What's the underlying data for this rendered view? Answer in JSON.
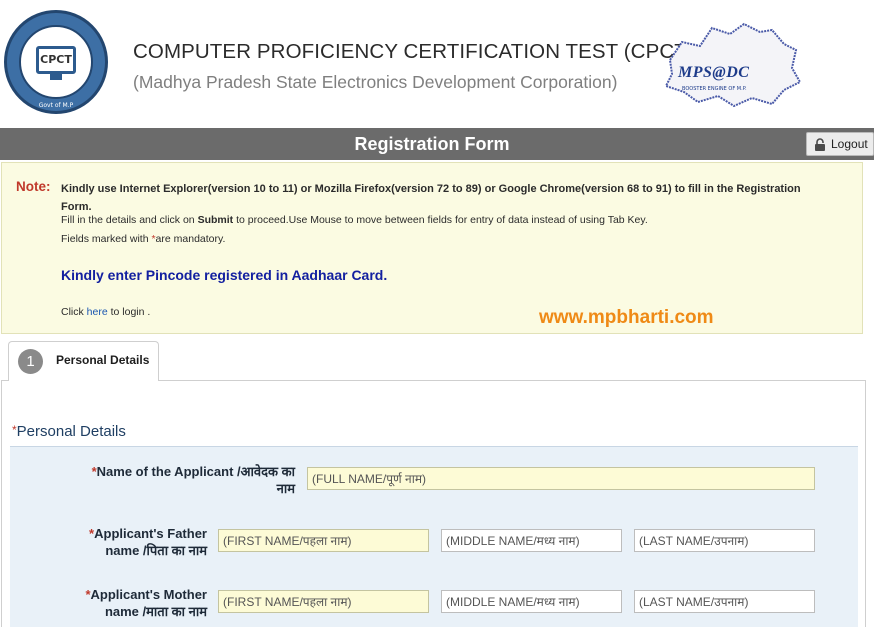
{
  "header": {
    "seal_text": "CPCT",
    "seal_caption": "Govt of M.P",
    "title": "COMPUTER PROFICIENCY CERTIFICATION TEST (CPCT)",
    "subtitle": "(Madhya Pradesh State Electronics Development Corporation)",
    "partner_logo_text": "MPS@DC",
    "partner_logo_tagline": "BOOSTER ENGINE OF M.P."
  },
  "banner": {
    "title": "Registration Form",
    "logout_label": "Logout"
  },
  "note": {
    "label": "Note:",
    "line1": "Kindly use Internet Explorer(version 10 to 11) or Mozilla Firefox(version 72 to 89) or Google Chrome(version 68 to 91) to fill in the Registration Form.",
    "line2_prefix": "Fill in the details and click on ",
    "line2_bold": "Submit",
    "line2_suffix": " to proceed.Use Mouse to move between fields for entry of data instead of using Tab Key.",
    "line3_prefix": "Fields marked with ",
    "line3_star": "*",
    "line3_suffix": "are mandatory.",
    "aadhaar_notice": "Kindly enter Pincode registered in Aadhaar Card.",
    "click_prefix": "Click ",
    "click_link": "here",
    "click_suffix": " to login .",
    "watermark": "www.mpbharti.com"
  },
  "tab": {
    "number": "1",
    "label": "Personal Details"
  },
  "section": {
    "star": "*",
    "title": "Personal Details"
  },
  "fields": {
    "applicant_name": {
      "star": "*",
      "label_line1": "Name of the Applicant /आवेदक का",
      "label_line2": "नाम",
      "placeholder": "(FULL NAME/पूर्ण नाम)"
    },
    "father_name": {
      "star": "*",
      "label_line1": "Applicant's Father",
      "label_line2": "name /पिता का नाम",
      "first_placeholder": "(FIRST NAME/पहला नाम)",
      "middle_placeholder": "(MIDDLE NAME/मध्य नाम)",
      "last_placeholder": "(LAST NAME/उपनाम)"
    },
    "mother_name": {
      "star": "*",
      "label_line1": "Applicant's Mother",
      "label_line2": "name /माता का नाम",
      "first_placeholder": "(FIRST NAME/पहला नाम)",
      "middle_placeholder": "(MIDDLE NAME/मध्य नाम)",
      "last_placeholder": "(LAST NAME/उपनाम)"
    }
  },
  "colors": {
    "banner": "#6b6b6b",
    "note_bg": "#fbfbe2",
    "note_label": "#c0392b",
    "aadhaar_text": "#1320a0",
    "watermark": "#ef8a16",
    "form_bg": "#e9f1f8",
    "required_input_bg": "#fdfbd6"
  },
  "icons": {
    "logout": "lock-icon",
    "seal": "cpct-seal-logo",
    "partner": "mpsedc-map-logo"
  }
}
